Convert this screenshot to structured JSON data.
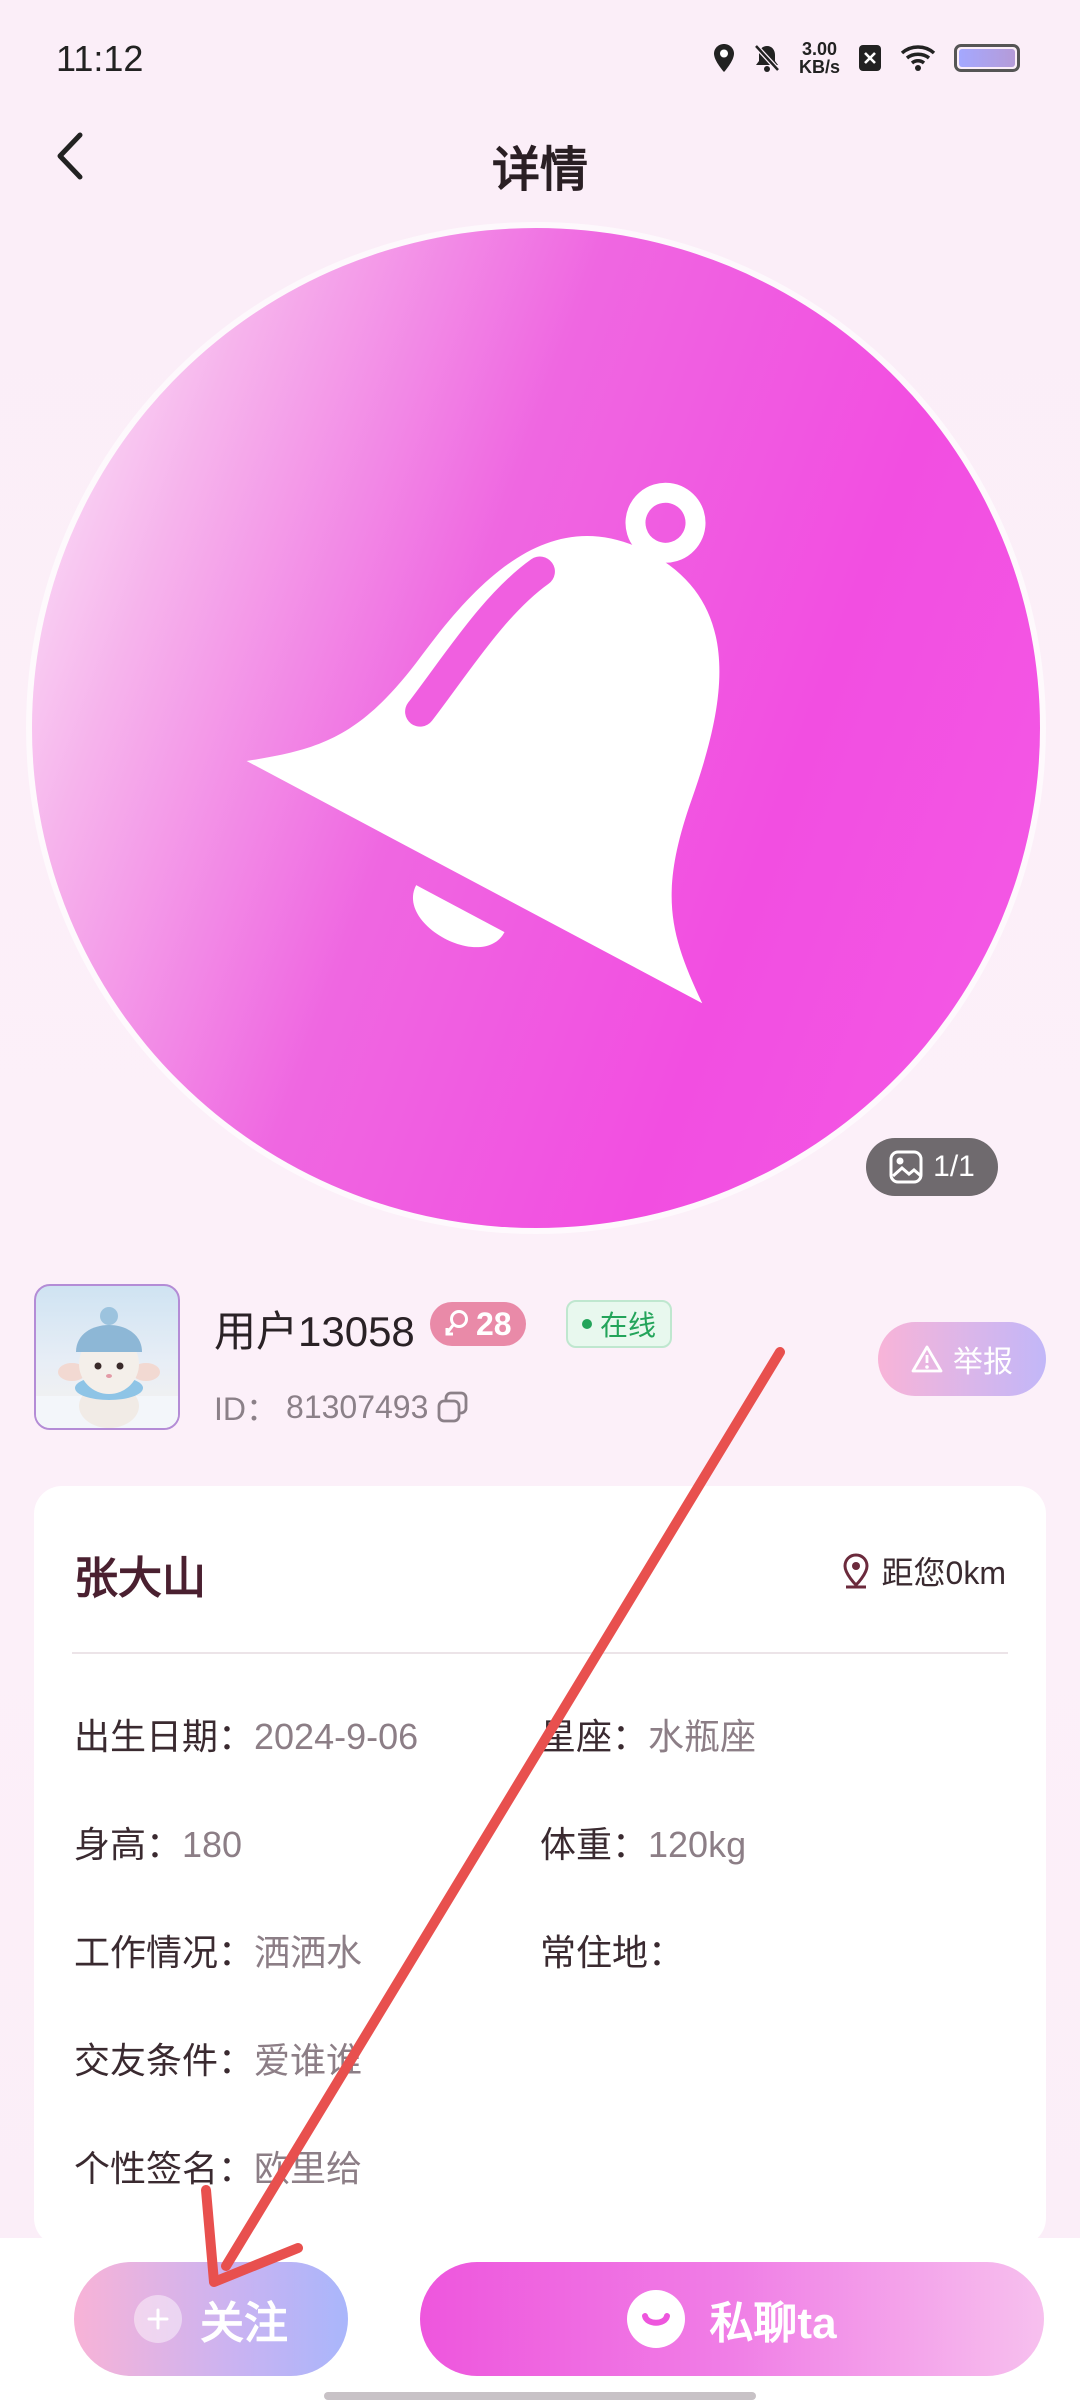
{
  "status_bar": {
    "time": "11:12",
    "net_speed_value": "3.00",
    "net_speed_unit": "KB/s"
  },
  "header": {
    "title": "详情"
  },
  "hero": {
    "photo_counter": "1/1",
    "colors": {
      "start": "#fdf2fb",
      "end": "#f24ee1"
    }
  },
  "profile": {
    "username": "用户13058",
    "age": "28",
    "online_label": "在线",
    "id_label": "ID：",
    "id_value": "81307493",
    "report_label": "举报"
  },
  "card": {
    "name": "张大山",
    "distance": "距您0km",
    "fields": {
      "birthday_label": "出生日期：",
      "birthday_value": "2024-9-06",
      "zodiac_label": "星座：",
      "zodiac_value": "水瓶座",
      "height_label": "身高：",
      "height_value": "180",
      "weight_label": "体重：",
      "weight_value": "120kg",
      "work_label": "工作情况：",
      "work_value": "洒洒水",
      "residence_label": "常住地：",
      "residence_value": "",
      "dating_label": "交友条件：",
      "dating_value": "爱谁谁",
      "signature_label": "个性签名：",
      "signature_value": "欧里给"
    }
  },
  "bottom": {
    "follow_label": "关注",
    "chat_label": "私聊ta"
  },
  "colors": {
    "accent_pink": "#f24ee1",
    "annotation_red": "#e8504e",
    "online_green": "#23a45a"
  }
}
